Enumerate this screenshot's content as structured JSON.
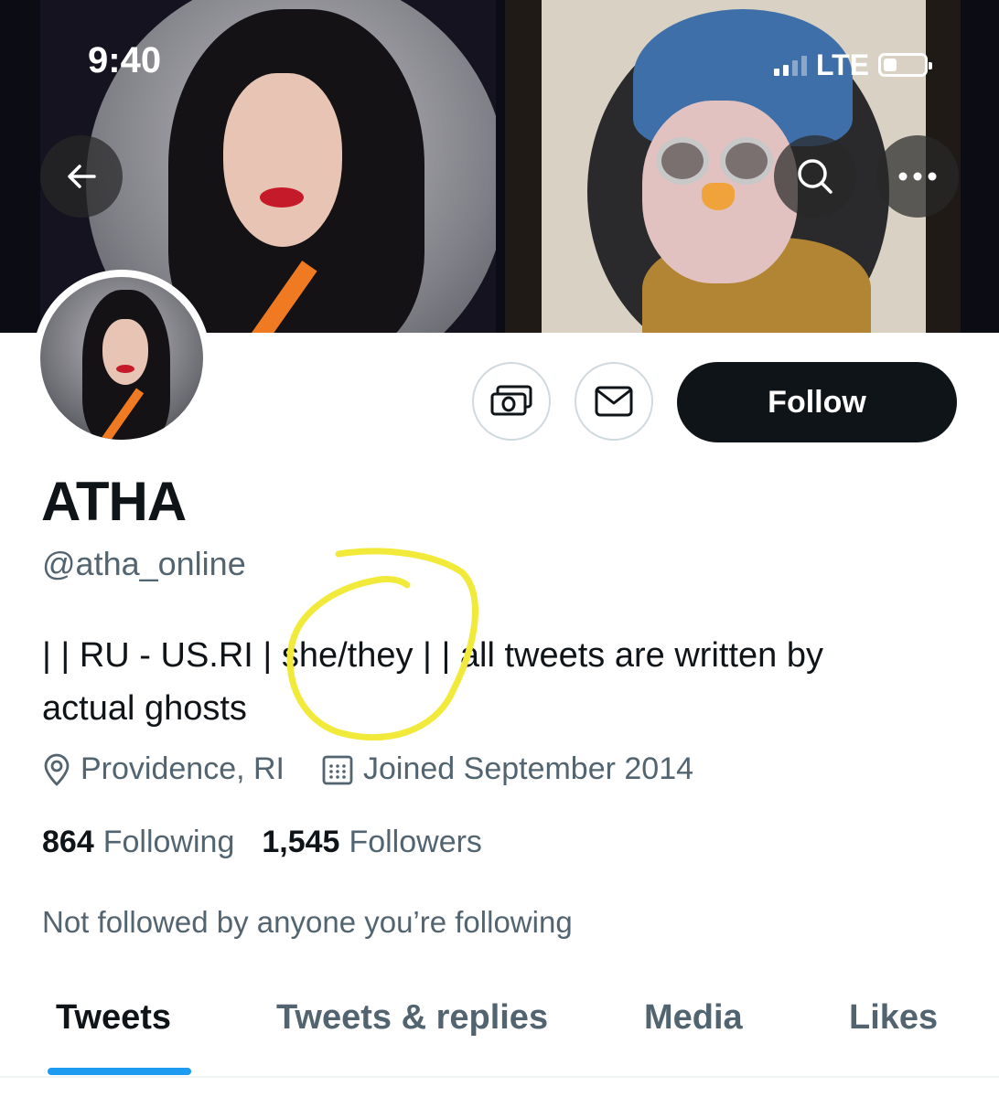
{
  "status_bar": {
    "time": "9:40",
    "network": "LTE",
    "battery_level": 0.25
  },
  "header": {
    "back_icon": "arrow-left-icon",
    "search_icon": "search-icon",
    "more_icon": "more-dots-icon"
  },
  "profile": {
    "display_name": "ATHA",
    "handle": "@atha_online",
    "bio_line1": "| | RU - US.RI | she/they | | all tweets are written by",
    "bio_line2": "actual ghosts",
    "location": "Providence, RI",
    "joined": "Joined September 2014",
    "following_count": "864",
    "following_label": "Following",
    "followers_count": "1,545",
    "followers_label": "Followers",
    "followed_by_note": "Not followed by anyone you’re following"
  },
  "actions": {
    "tip_icon": "money-icon",
    "message_icon": "envelope-icon",
    "follow_label": "Follow"
  },
  "tabs": [
    {
      "label": "Tweets",
      "active": true
    },
    {
      "label": "Tweets & replies",
      "active": false
    },
    {
      "label": "Media",
      "active": false
    },
    {
      "label": "Likes",
      "active": false
    }
  ],
  "colors": {
    "accent": "#1d9bf0",
    "text_primary": "#0f1419",
    "text_secondary": "#536471",
    "annotation": "#f2ea3a"
  }
}
